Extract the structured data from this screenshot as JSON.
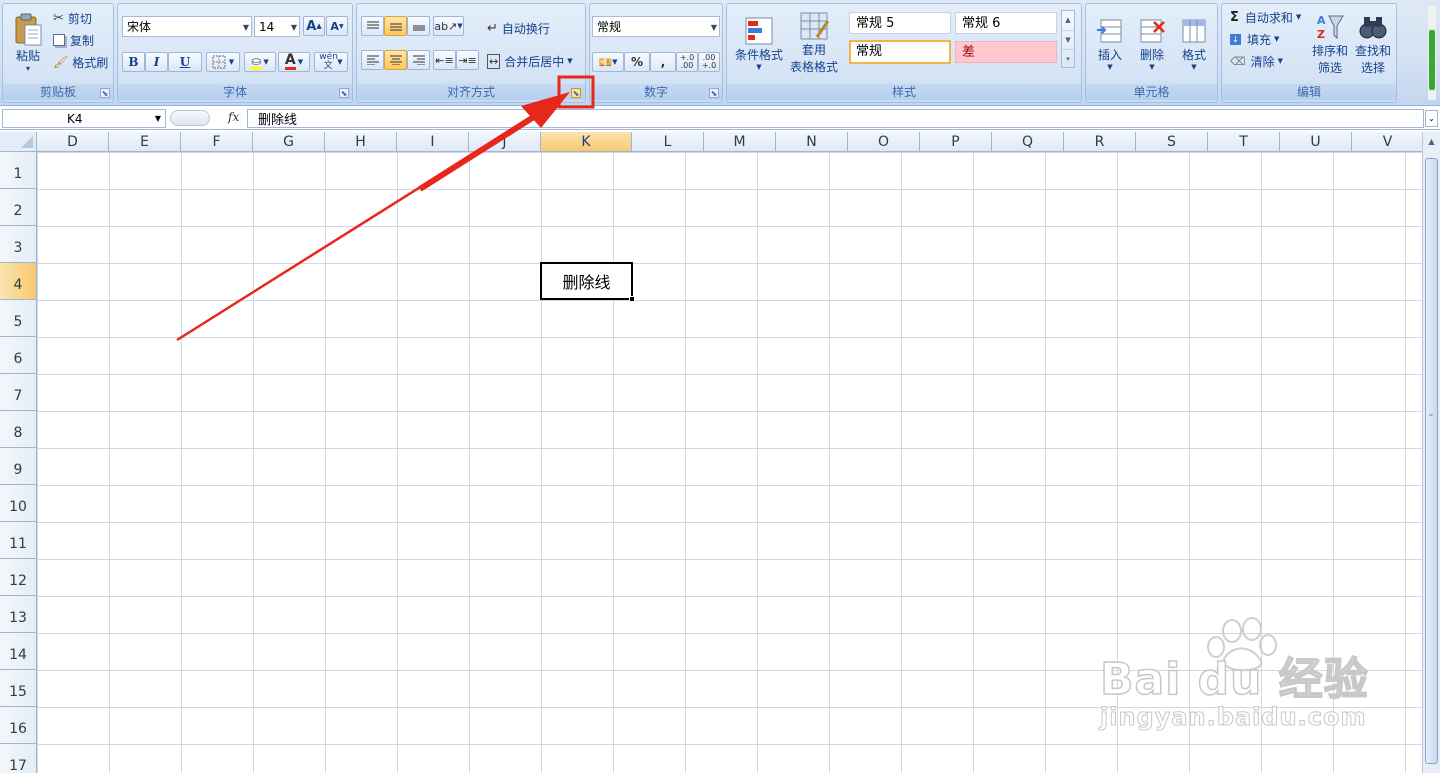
{
  "ribbon": {
    "clipboard": {
      "group_label": "剪贴板",
      "paste": "粘贴",
      "cut": "剪切",
      "copy": "复制",
      "format_painter": "格式刷"
    },
    "font": {
      "group_label": "字体",
      "font_name": "宋体",
      "font_size": "14",
      "bold": "B",
      "italic": "I",
      "underline": "U",
      "font_color_glyph": "A",
      "phonetic_glyph": "wén 文"
    },
    "alignment": {
      "group_label": "对齐方式",
      "wrap_text": "自动换行",
      "merge_center": "合并后居中"
    },
    "number": {
      "group_label": "数字",
      "format": "常规",
      "percent": "%",
      "comma": ",",
      "inc_decimal": "+.0 .00",
      "dec_decimal": ".00 +.0"
    },
    "styles": {
      "group_label": "样式",
      "conditional": "条件格式",
      "table_format_1": "套用",
      "table_format_2": "表格格式",
      "style_1": "常规 5",
      "style_2": "常规 6",
      "style_3": "常规",
      "style_4": "差"
    },
    "cells": {
      "group_label": "单元格",
      "insert": "插入",
      "delete": "删除",
      "format": "格式"
    },
    "editing": {
      "group_label": "编辑",
      "autosum": "自动求和",
      "fill": "填充",
      "clear": "清除",
      "sort_filter_1": "排序和",
      "sort_filter_2": "筛选",
      "find_select_1": "查找和",
      "find_select_2": "选择"
    }
  },
  "formula_bar": {
    "name_box": "K4",
    "fx": "fx",
    "content": "删除线"
  },
  "sheet": {
    "columns": [
      "D",
      "E",
      "F",
      "G",
      "H",
      "I",
      "J",
      "K",
      "L",
      "M",
      "N",
      "O",
      "P",
      "Q",
      "R",
      "S",
      "T",
      "U",
      "V"
    ],
    "selected_column": "K",
    "rows": [
      "1",
      "2",
      "3",
      "4",
      "5",
      "6",
      "7",
      "8",
      "9",
      "10",
      "11",
      "12",
      "13",
      "14",
      "15",
      "16",
      "17"
    ],
    "selected_row": "4",
    "active_cell": {
      "ref": "K4",
      "value": "删除线"
    }
  },
  "watermark": {
    "brand": "Bai du 经验",
    "url": "jingyan.baidu.com"
  },
  "colors": {
    "accent_red": "#e8271c",
    "ribbon_bg": "#d3e1f2",
    "selected_header": "#f9c86f",
    "bad_style": "#ffc7ce",
    "bad_style_text": "#9c0006"
  }
}
